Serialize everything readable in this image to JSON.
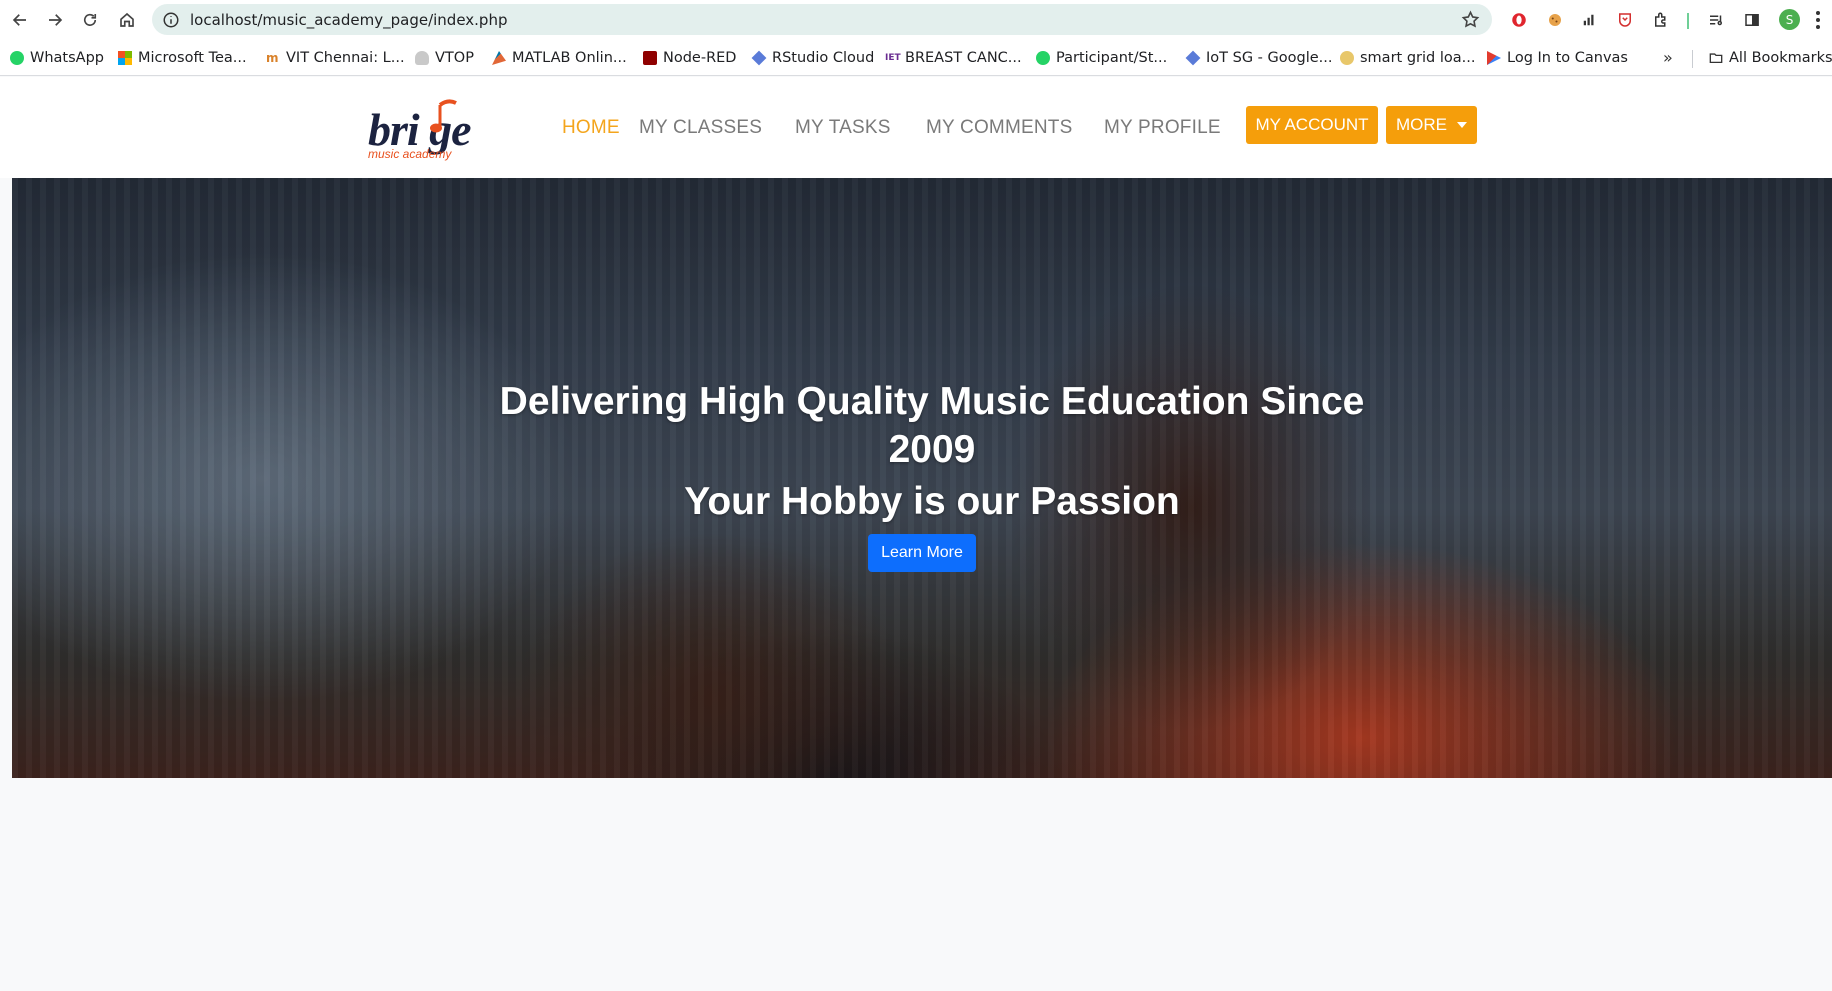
{
  "browser": {
    "url": "localhost/music_academy_page/index.php",
    "profile_initial": "S",
    "bookmarks": [
      {
        "label": "WhatsApp",
        "icon": "whatsapp-icon"
      },
      {
        "label": "Microsoft Tea...",
        "icon": "microsoft-icon"
      },
      {
        "label": "VIT Chennai: L...",
        "icon": "vit-icon"
      },
      {
        "label": "VTOP",
        "icon": "vtop-icon"
      },
      {
        "label": "MATLAB Onlin...",
        "icon": "matlab-icon"
      },
      {
        "label": "Node-RED",
        "icon": "node-red-icon"
      },
      {
        "label": "RStudio Cloud",
        "icon": "rstudio-icon"
      },
      {
        "label": "BREAST CANC...",
        "icon": "iet-icon"
      },
      {
        "label": "Participant/St...",
        "icon": "whatsapp-icon"
      },
      {
        "label": "IoT SG - Google...",
        "icon": "rstudio-icon"
      },
      {
        "label": "smart grid loa...",
        "icon": "smart-grid-icon"
      },
      {
        "label": "Log In to Canvas",
        "icon": "canvas-icon"
      }
    ],
    "more_bookmarks": "»",
    "all_bookmarks": "All Bookmarks"
  },
  "site": {
    "logo_text": "bri ge",
    "logo_sub": "music academy",
    "menu": [
      {
        "label": "HOME",
        "active": true
      },
      {
        "label": "MY CLASSES",
        "active": false
      },
      {
        "label": "MY TASKS",
        "active": false
      },
      {
        "label": "MY COMMENTS",
        "active": false
      },
      {
        "label": "MY PROFILE",
        "active": false
      }
    ],
    "account_button": "MY ACCOUNT",
    "more_button": "MORE",
    "accent_color": "#f59e0b"
  },
  "hero": {
    "title": "Delivering High Quality Music Education Since 2009",
    "subtitle": "Your Hobby is our Passion",
    "cta": "Learn More",
    "cta_color": "#0d6efd"
  }
}
